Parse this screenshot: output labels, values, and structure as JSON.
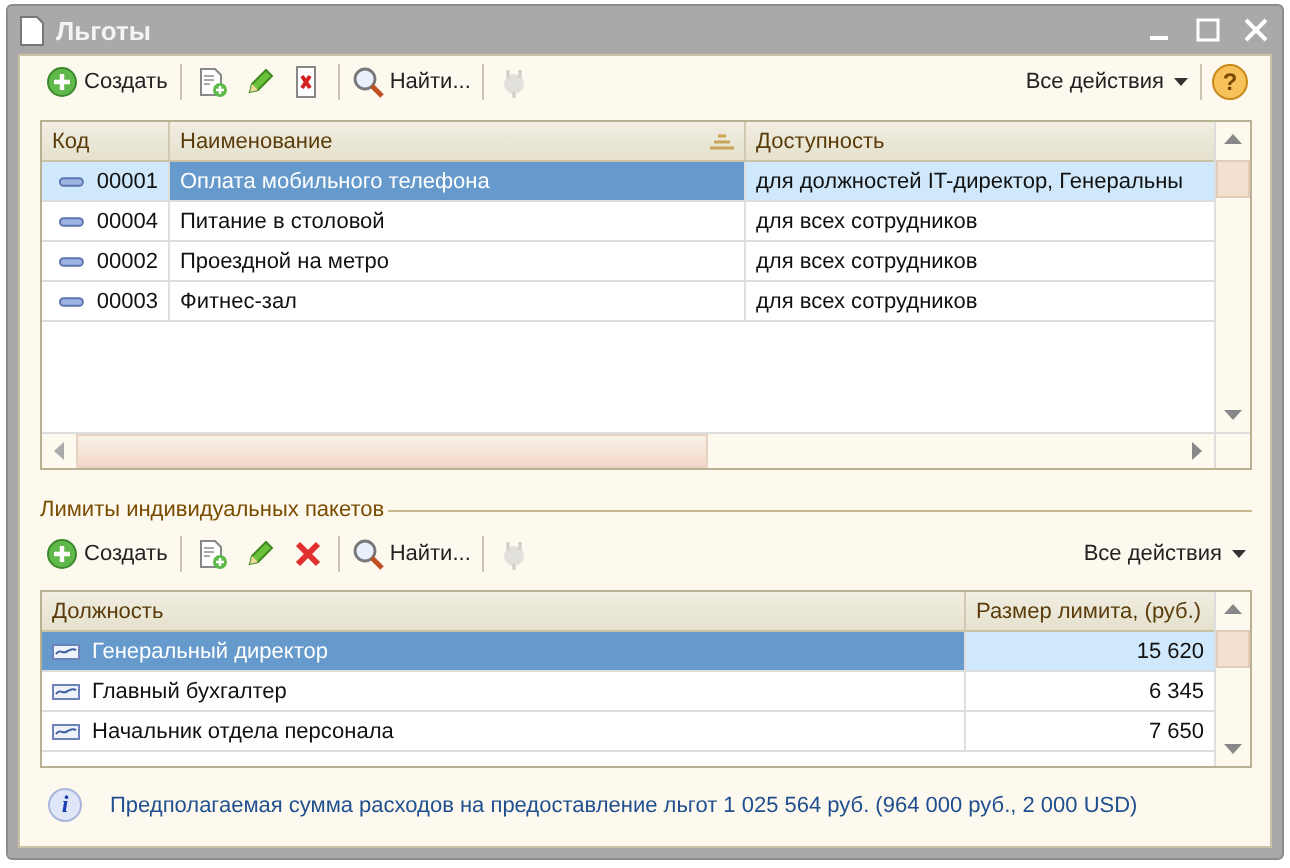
{
  "window": {
    "title": "Льготы"
  },
  "toolbar": {
    "items": [
      {
        "kind": "create",
        "label": "Создать",
        "disabled": false
      },
      {
        "kind": "separator"
      },
      {
        "kind": "copy",
        "disabled": false
      },
      {
        "kind": "edit",
        "disabled": false
      },
      {
        "kind": "delete-doc",
        "disabled": false
      },
      {
        "kind": "separator"
      },
      {
        "kind": "find",
        "label": "Найти...",
        "disabled": false
      },
      {
        "kind": "separator"
      },
      {
        "kind": "plug",
        "disabled": true
      }
    ],
    "all_actions": "Все действия",
    "help": "?"
  },
  "benefits_table": {
    "columns": [
      {
        "label": "Код",
        "selected": false,
        "sorted": false
      },
      {
        "label": "Наименование",
        "selected": true,
        "sorted": true
      },
      {
        "label": "Доступность",
        "selected": false,
        "sorted": false
      }
    ],
    "rows": [
      {
        "selected": true,
        "cells": [
          "00001",
          "Оплата мобильного телефона",
          "для должностей IT-директор, Генеральны"
        ]
      },
      {
        "selected": false,
        "cells": [
          "00004",
          "Питание в столовой",
          "для всех сотрудников"
        ]
      },
      {
        "selected": false,
        "cells": [
          "00002",
          "Проездной на метро",
          "для всех сотрудников"
        ]
      },
      {
        "selected": false,
        "cells": [
          "00003",
          "Фитнес-зал",
          "для всех сотрудников"
        ]
      }
    ]
  },
  "limits_section": {
    "title": "Лимиты индивидуальных пакетов",
    "toolbar": {
      "items": [
        {
          "kind": "create",
          "label": "Создать",
          "disabled": false
        },
        {
          "kind": "separator"
        },
        {
          "kind": "copy",
          "disabled": false
        },
        {
          "kind": "edit",
          "disabled": false
        },
        {
          "kind": "delete",
          "disabled": false
        },
        {
          "kind": "separator"
        },
        {
          "kind": "find",
          "label": "Найти...",
          "disabled": false
        },
        {
          "kind": "separator"
        },
        {
          "kind": "plug",
          "disabled": true
        }
      ],
      "all_actions": "Все действия"
    },
    "table": {
      "columns": [
        {
          "label": "Должность",
          "selected": true,
          "sorted": false
        },
        {
          "label": "Размер лимита, (руб.)",
          "selected": false,
          "sorted": false
        }
      ],
      "rows": [
        {
          "selected": true,
          "cells": [
            "Генеральный директор",
            "15 620"
          ]
        },
        {
          "selected": false,
          "cells": [
            "Главный бухгалтер",
            "6 345"
          ]
        },
        {
          "selected": false,
          "cells": [
            "Начальник отдела персонала",
            "7 650"
          ]
        }
      ]
    }
  },
  "info": {
    "icon": "i",
    "text": "Предполагаемая сумма расходов на предоставление льгот 1 025 564 руб. (964 000 руб., 2 000 USD)"
  }
}
